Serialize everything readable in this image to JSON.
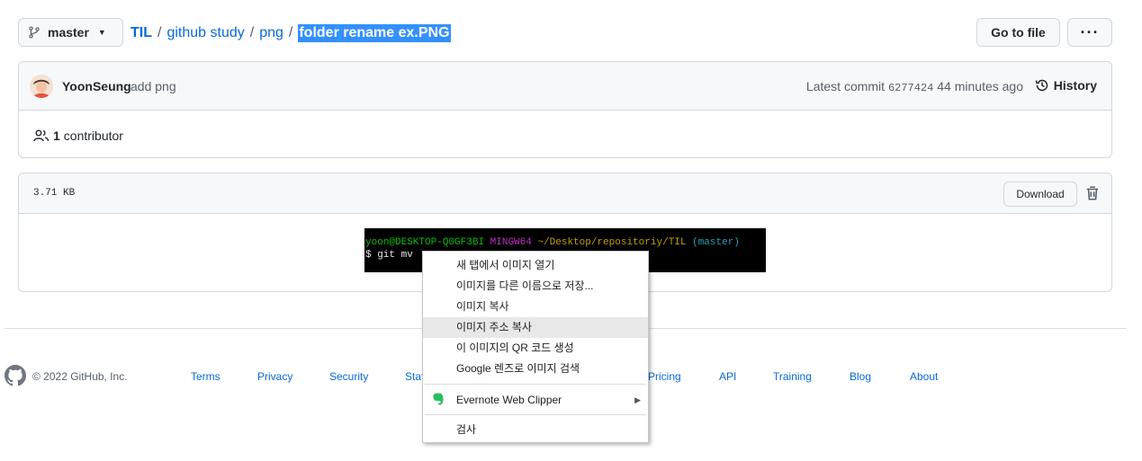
{
  "header": {
    "branch": "master",
    "breadcrumb": {
      "repo": "TIL",
      "folder1": "github study",
      "folder2": "png",
      "file": "folder rename ex.PNG",
      "sep": "/"
    },
    "goto_file": "Go to file",
    "more": "···"
  },
  "commit": {
    "author": "YoonSeung",
    "message": "add png",
    "latest_label": "Latest commit",
    "sha": "6277424",
    "time": "44 minutes ago",
    "history": "History",
    "contributors_count": "1",
    "contributors_label": "contributor"
  },
  "file": {
    "size": "3.71 KB",
    "download": "Download"
  },
  "terminal": {
    "user_host": "yoon@DESKTOP-Q0GF3BI",
    "env": "MINGW64",
    "path": "~/Desktop/repositoriy/TIL",
    "branch": "(master)",
    "command": "$ git mv"
  },
  "context_menu": {
    "items": [
      "새 탭에서 이미지 열기",
      "이미지를 다른 이름으로 저장...",
      "이미지 복사",
      "이미지 주소 복사",
      "이 이미지의 QR 코드 생성",
      "Google 렌즈로 이미지 검색",
      "Evernote Web Clipper",
      "검사"
    ]
  },
  "footer": {
    "copyright": "© 2022 GitHub, Inc.",
    "links": [
      "Terms",
      "Privacy",
      "Security",
      "Stat",
      "Pricing",
      "API",
      "Training",
      "Blog",
      "About"
    ]
  },
  "colors": {
    "link": "#0969da",
    "selection": "#3390ff",
    "evernote": "#2dbe60"
  }
}
